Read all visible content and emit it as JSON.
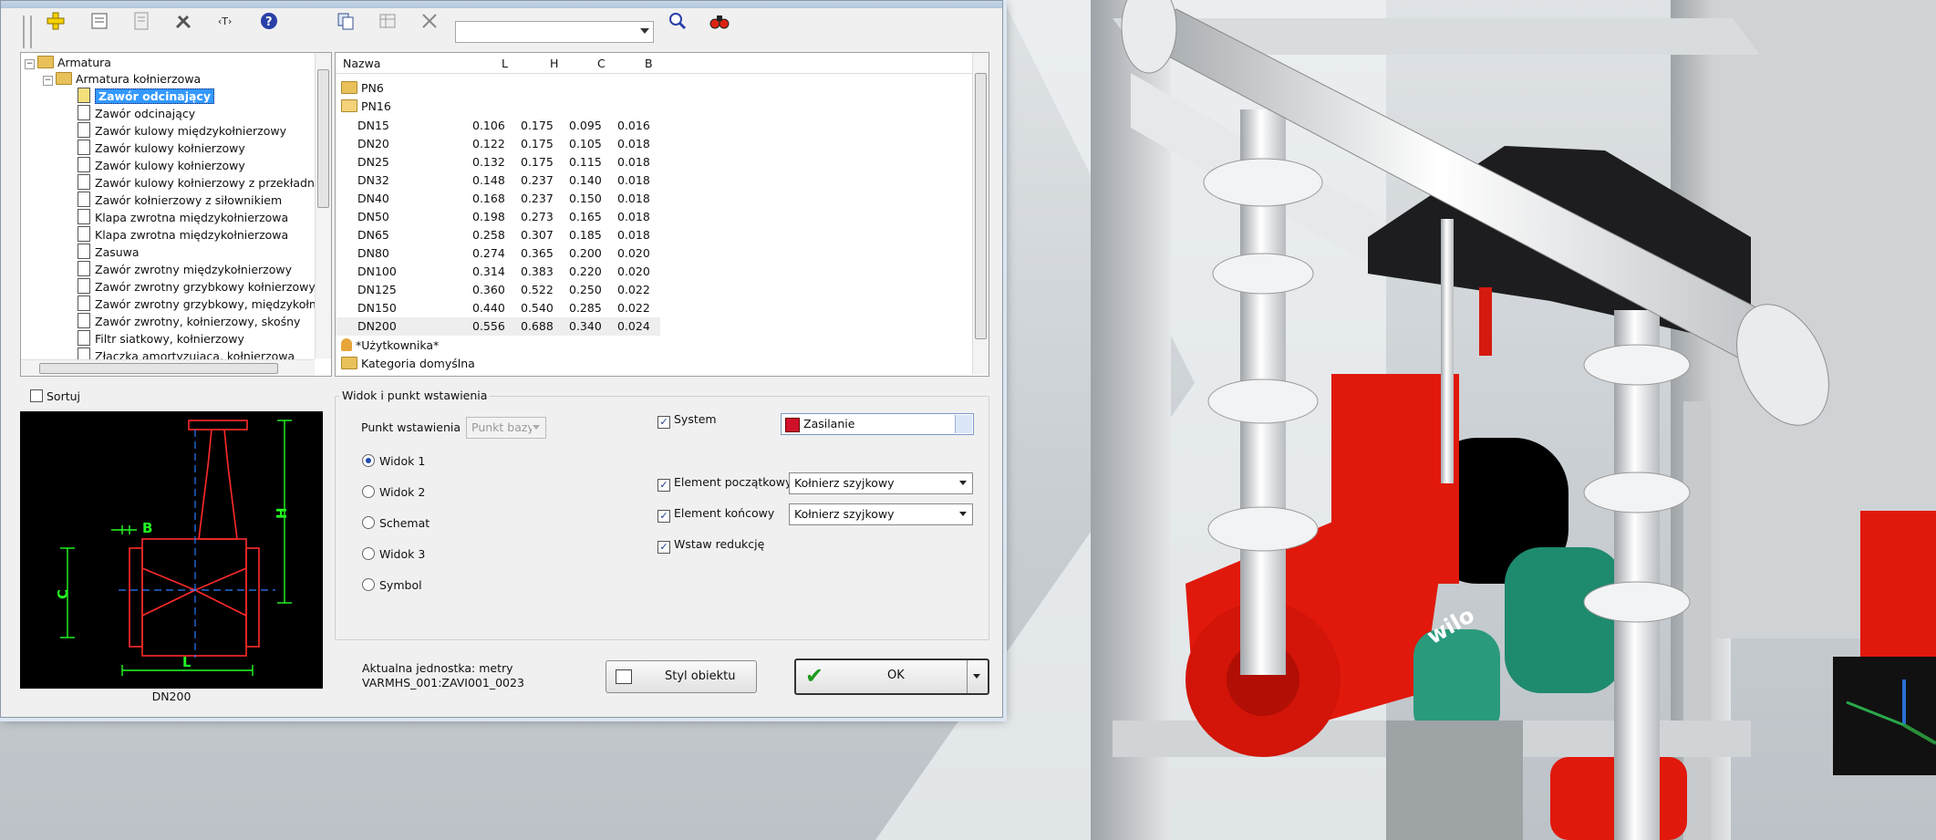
{
  "toolbar": {
    "icons": [
      "add-icon",
      "edit-icon",
      "list-icon",
      "tools-icon",
      "text-format-icon",
      "help-icon",
      "copy-icon",
      "table-icon",
      "delete-icon",
      "search-icon",
      "binoculars-icon"
    ],
    "search_value": ""
  },
  "tree": {
    "root": "Armatura",
    "group": "Armatura kołnierzowa",
    "items": [
      "Zawór odcinający",
      "Zawór odcinający",
      "Zawór kulowy międzykołnierzowy",
      "Zawór kulowy kołnierzowy",
      "Zawór kulowy kołnierzowy",
      "Zawór kulowy kołnierzowy z przekładnią",
      "Zawór kołnierzowy z siłownikiem",
      "Klapa zwrotna międzykołnierzowa",
      "Klapa zwrotna międzykołnierzowa",
      "Zasuwa",
      "Zawór zwrotny międzykołnierzowy",
      "Zawór zwrotny grzybkowy kołnierzowy",
      "Zawór zwrotny grzybkowy, międzykołn",
      "Zawór zwrotny, kołnierzowy, skośny",
      "Filtr siatkowy, kołnierzowy",
      "Złączka amortyzująca, kołnierzowa"
    ]
  },
  "list": {
    "columns": [
      "Nazwa",
      "L",
      "H",
      "C",
      "B"
    ],
    "folders": [
      "PN6",
      "PN16"
    ],
    "rows": [
      {
        "name": "DN15",
        "L": "0.106",
        "H": "0.175",
        "C": "0.095",
        "B": "0.016"
      },
      {
        "name": "DN20",
        "L": "0.122",
        "H": "0.175",
        "C": "0.105",
        "B": "0.018"
      },
      {
        "name": "DN25",
        "L": "0.132",
        "H": "0.175",
        "C": "0.115",
        "B": "0.018"
      },
      {
        "name": "DN32",
        "L": "0.148",
        "H": "0.237",
        "C": "0.140",
        "B": "0.018"
      },
      {
        "name": "DN40",
        "L": "0.168",
        "H": "0.237",
        "C": "0.150",
        "B": "0.018"
      },
      {
        "name": "DN50",
        "L": "0.198",
        "H": "0.273",
        "C": "0.165",
        "B": "0.018"
      },
      {
        "name": "DN65",
        "L": "0.258",
        "H": "0.307",
        "C": "0.185",
        "B": "0.018"
      },
      {
        "name": "DN80",
        "L": "0.274",
        "H": "0.365",
        "C": "0.200",
        "B": "0.020"
      },
      {
        "name": "DN100",
        "L": "0.314",
        "H": "0.383",
        "C": "0.220",
        "B": "0.020"
      },
      {
        "name": "DN125",
        "L": "0.360",
        "H": "0.522",
        "C": "0.250",
        "B": "0.022"
      },
      {
        "name": "DN150",
        "L": "0.440",
        "H": "0.540",
        "C": "0.285",
        "B": "0.022"
      },
      {
        "name": "DN200",
        "L": "0.556",
        "H": "0.688",
        "C": "0.340",
        "B": "0.024"
      }
    ],
    "user_category": "*Użytkownika*",
    "default_category": "Kategoria domyślna"
  },
  "preview": {
    "sort_label": "Sortuj",
    "dim_labels": {
      "B": "B",
      "H": "H",
      "C": "C",
      "L": "L"
    },
    "caption": "DN200"
  },
  "view": {
    "legend": "Widok i punkt wstawienia",
    "insert_label": "Punkt wstawienia",
    "insert_value": "Punkt bazy",
    "radios": [
      "Widok 1",
      "Widok 2",
      "Schemat",
      "Widok 3",
      "Symbol"
    ],
    "system_label": "System",
    "system_value": "Zasilanie",
    "system_color": "#d0102a",
    "start_label": "Element początkowy",
    "start_value": "Kołnierz szyjkowy",
    "end_label": "Element końcowy",
    "end_value": "Kołnierz szyjkowy",
    "reduction_label": "Wstaw redukcję"
  },
  "footer": {
    "unit": "Aktualna jednostka: metry",
    "code": "VARMHS_001:ZAVI001_0023",
    "style_button": "Styl obiektu",
    "ok_button": "OK"
  },
  "scene": {
    "brand": "wilo",
    "pump_red": "#e0190c",
    "pump_green": "#1e8a6e"
  }
}
